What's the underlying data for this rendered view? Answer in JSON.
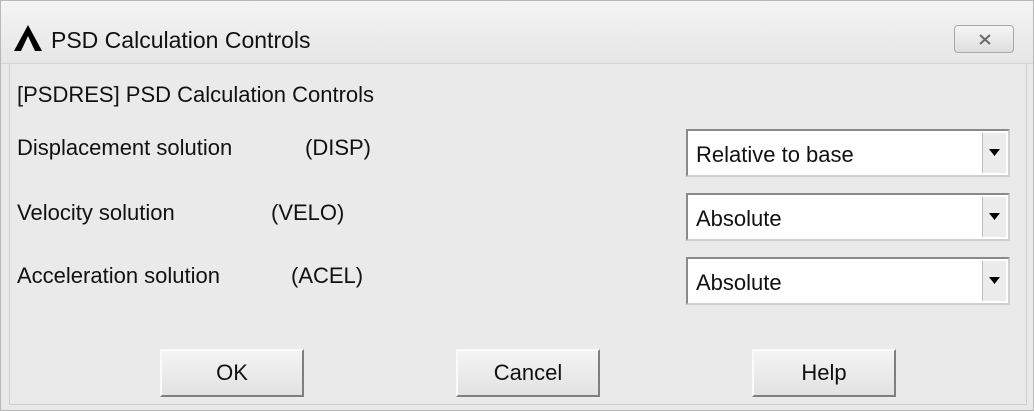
{
  "window": {
    "title": "PSD Calculation Controls",
    "app_icon": "ansys-lambda-icon",
    "close_icon": "close-icon"
  },
  "dialog": {
    "heading": "[PSDRES]  PSD Calculation Controls",
    "rows": [
      {
        "label": "Displacement solution",
        "code": "(DISP)",
        "value": "Relative to base"
      },
      {
        "label": "Velocity solution",
        "code": "(VELO)",
        "value": "Absolute"
      },
      {
        "label": "Acceleration solution",
        "code": "(ACEL)",
        "value": "Absolute"
      }
    ]
  },
  "buttons": {
    "ok": "OK",
    "cancel": "Cancel",
    "help": "Help"
  },
  "colors": {
    "window_bg": "#e9e9e9",
    "field_bg": "#ffffff"
  }
}
